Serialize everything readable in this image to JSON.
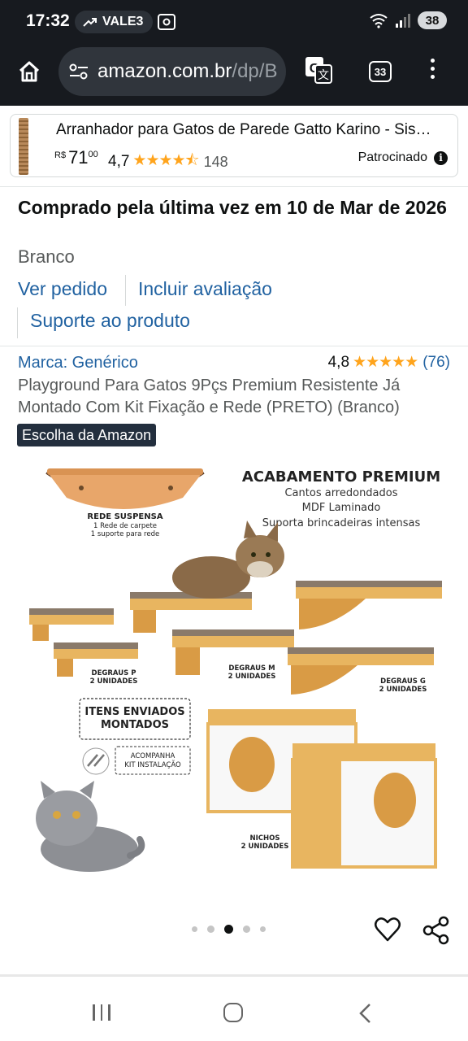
{
  "status_bar": {
    "time": "17:32",
    "carrier_pill": "VALE3",
    "battery": "38"
  },
  "browser": {
    "url_domain": "amazon.com.br",
    "url_path": "/dp/B",
    "tab_count": "33"
  },
  "sponsored": {
    "title": "Arranhador para Gatos de Parede Gatto Karino - Sisal...",
    "currency": "R$",
    "price_int": "71",
    "price_dec": "00",
    "rating": "4,7",
    "stars": "★★★★⯪",
    "review_count": "148",
    "label": "Patrocinado",
    "info_icon": "i"
  },
  "purchase": {
    "last_purchased": "Comprado pela última vez em 10 de Mar de 2026",
    "variant": "Branco",
    "view_order": "Ver pedido",
    "add_review": "Incluir avaliação",
    "support": "Suporte ao produto"
  },
  "product": {
    "brand": "Marca: Genérico",
    "rating": "4,8",
    "stars": "★★★★★",
    "review_count": "(76)",
    "title": "Playground Para Gatos 9Pçs Premium Resistente Já Montado Com Kit Fixação e Rede (PRETO) (Branco)",
    "badge": "Escolha da Amazon"
  },
  "product_image": {
    "heading": "ACABAMENTO PREMIUM",
    "features": [
      "Cantos arredondados",
      "MDF Laminado",
      "Suporta brincadeiras intensas"
    ],
    "hammock_label": [
      "REDE SUSPENSA",
      "1 Rede de carpete",
      "1 suporte para rede"
    ],
    "steps_p": [
      "DEGRAUS P",
      "2 UNIDADES"
    ],
    "steps_m": [
      "DEGRAUS M",
      "2 UNIDADES"
    ],
    "steps_g": [
      "DEGRAUS G",
      "2 UNIDADES"
    ],
    "niches": [
      "NICHOS",
      "2 UNIDADES"
    ],
    "assembled": [
      "ITENS ENVIADOS",
      "MONTADOS"
    ],
    "kit": [
      "ACOMPANHA",
      "KIT INSTALAÇÃO"
    ]
  },
  "carousel": {
    "count": 5,
    "active_index": 2
  },
  "colors": {
    "link": "#2162a1",
    "star": "#ffa41c",
    "badge_bg": "#232f3e",
    "browser_bg": "#171a1f",
    "wood": "#e8b560",
    "carpet": "#8a7a6a"
  }
}
